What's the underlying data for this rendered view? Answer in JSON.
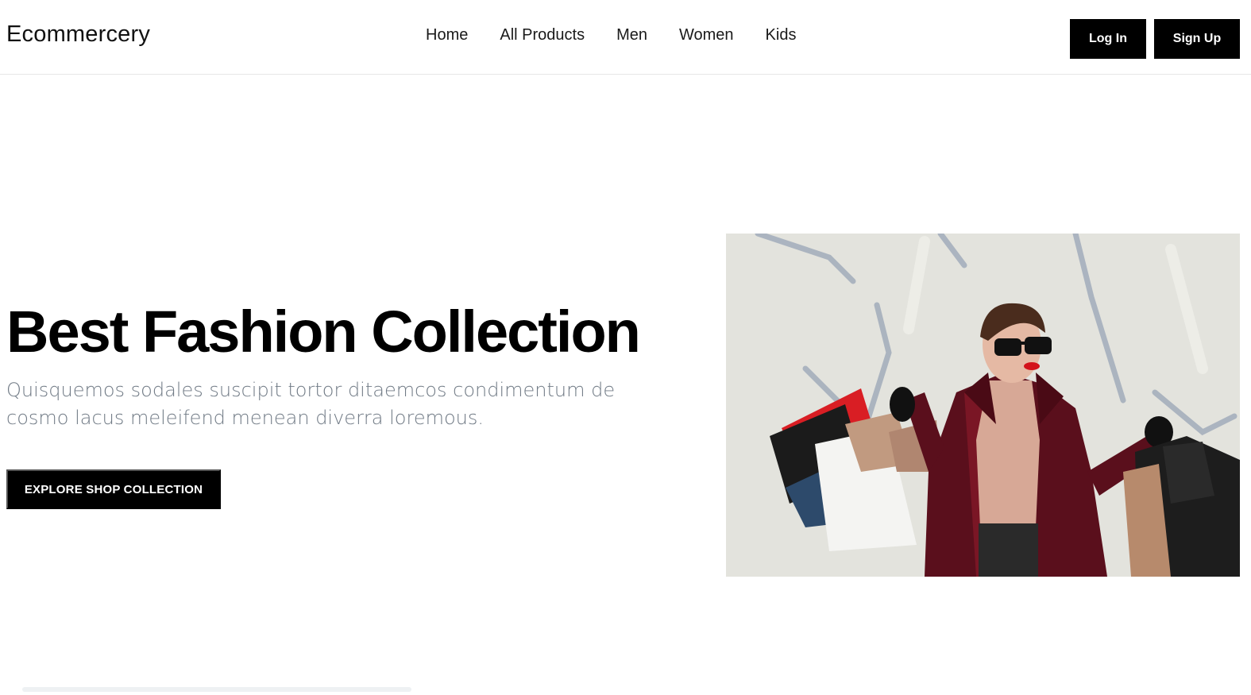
{
  "brand": {
    "name": "Ecommercery"
  },
  "nav": {
    "items": [
      {
        "label": "Home"
      },
      {
        "label": "All Products"
      },
      {
        "label": "Men"
      },
      {
        "label": "Women"
      },
      {
        "label": "Kids"
      }
    ]
  },
  "auth": {
    "login_label": "Log In",
    "signup_label": "Sign Up"
  },
  "hero": {
    "title": "Best Fashion Collection",
    "subtitle": "Quisquemos sodales suscipit tortor ditaemcos condimentum de cosmo lacus meleifend menean diverra loremous.",
    "cta_label": "EXPLORE SHOP COLLECTION",
    "image_subject": "woman-with-shopping-bags-photo"
  },
  "colors": {
    "primary": "#000000",
    "text_muted": "#707a85",
    "coat": "#5a0f1c",
    "bag_red": "#e01a22"
  }
}
